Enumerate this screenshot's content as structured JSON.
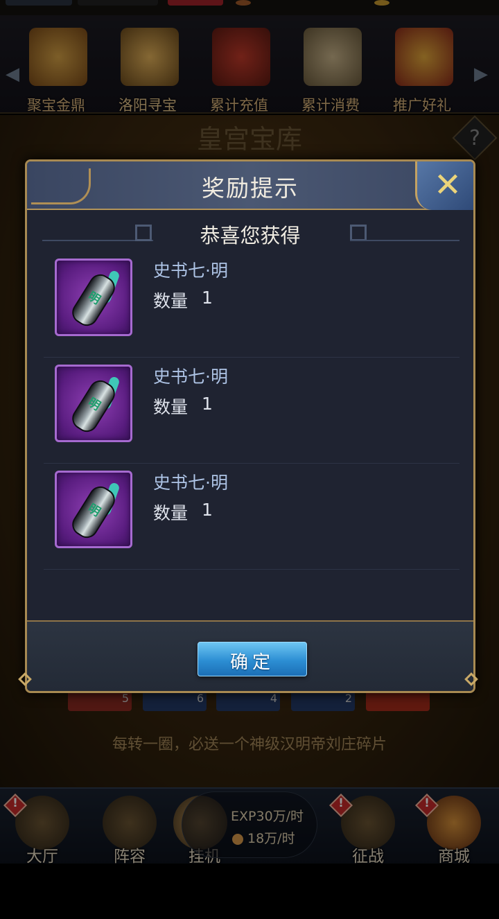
{
  "events": {
    "items": [
      {
        "label": "聚宝金鼎",
        "icon": "cauldron-icon"
      },
      {
        "label": "洛阳寻宝",
        "icon": "palace-icon"
      },
      {
        "label": "累计充值",
        "icon": "treasure-chest-icon"
      },
      {
        "label": "累计消费",
        "icon": "money-bag-icon"
      },
      {
        "label": "推广好礼",
        "icon": "gift-box-icon"
      }
    ]
  },
  "scene": {
    "title": "皇宫宝库",
    "cards": [
      "5",
      "6",
      "4",
      "2"
    ],
    "ticker": "每转一圈，必送一个神级汉明帝刘庄碎片"
  },
  "dialog": {
    "title": "奖励提示",
    "subtitle": "恭喜您获得",
    "rewards": [
      {
        "name": "史书七·明",
        "qty_label": "数量",
        "qty": "1",
        "icon_char": "明"
      },
      {
        "name": "史书七·明",
        "qty_label": "数量",
        "qty": "1",
        "icon_char": "明"
      },
      {
        "name": "史书七·明",
        "qty_label": "数量",
        "qty": "1",
        "icon_char": "明"
      }
    ],
    "confirm_label": "确定"
  },
  "bottom_nav": {
    "items": [
      {
        "label": "大厅",
        "alert": "!"
      },
      {
        "label": "阵容",
        "alert": ""
      },
      {
        "label": "挂机",
        "alert": ""
      },
      {
        "label": "征战",
        "alert": "!"
      },
      {
        "label": "商城",
        "alert": "!"
      }
    ],
    "idle": {
      "exp_rate": "EXP30万/时",
      "coin_rate": "18万/时"
    }
  },
  "colors": {
    "accent_gold": "#a88a52",
    "button_blue": "#2c8ed3",
    "item_purple": "#8f3fb4"
  }
}
